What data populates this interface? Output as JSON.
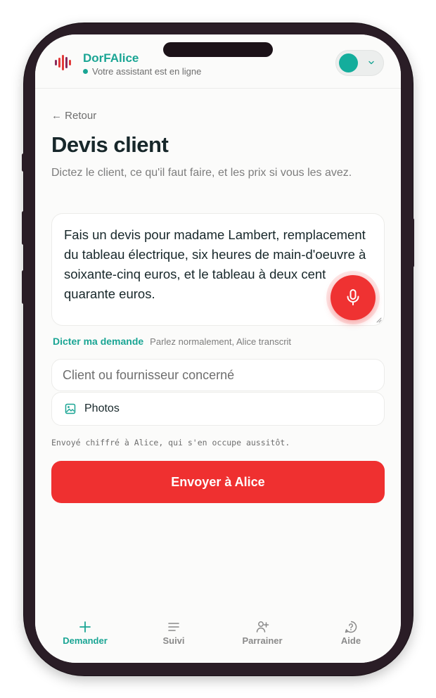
{
  "header": {
    "brand": "DorFAlice",
    "status_text": "Votre assistant est en ligne",
    "logo_icon": "audio-wave-icon",
    "toggle_icon": "chevron-down-icon",
    "colors": {
      "accent": "#1aa594",
      "primary_action": "#ef3030",
      "logo_red": "#e23a3a",
      "logo_dark": "#8a2b5c"
    }
  },
  "page": {
    "back_label": "← Retour",
    "title": "Devis client",
    "subtitle": "Dictez le client, ce qu'il faut faire, et les prix si vous les avez."
  },
  "request": {
    "text": "Fais un devis pour madame Lambert, remplacement du tableau électrique, six heures de main-d'oeuvre à soixante-cinq euros, et le tableau à deux cent quarante euros.",
    "mic_icon": "microphone-icon",
    "dictate_label": "Dicter ma demande",
    "dictate_hint": "Parlez normalement, Alice transcrit"
  },
  "client_field": {
    "placeholder": "Client ou fournisseur concerné",
    "value": ""
  },
  "photos": {
    "label": "Photos",
    "icon": "image-icon"
  },
  "note": "Envoyé chiffré à Alice, qui s'en occupe aussitôt.",
  "send_button": {
    "label": "Envoyer à Alice"
  },
  "nav": {
    "items": [
      {
        "label": "Demander",
        "icon": "plus-icon",
        "active": true
      },
      {
        "label": "Suivi",
        "icon": "list-icon",
        "active": false
      },
      {
        "label": "Parrainer",
        "icon": "user-plus-icon",
        "active": false
      },
      {
        "label": "Aide",
        "icon": "help-bubble-icon",
        "active": false
      }
    ]
  }
}
